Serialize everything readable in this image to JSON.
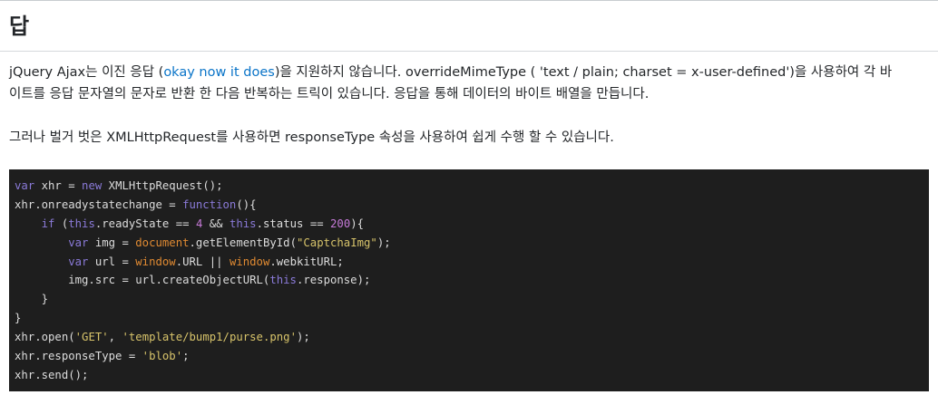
{
  "answer": {
    "heading": "답",
    "para1_before_link": "jQuery Ajax는 이진 응답 (",
    "para1_link": "okay now it does",
    "para1_after_link_line1": ")을 지원하지 않습니다. overrideMimeType ( 'text / plain; charset = x-user-defined')을 사용하여 각 바",
    "para1_line2": "이트를 응답 문자열의 문자로 반환 한 다음 반복하는 트릭이 있습니다. 응답을 통해 데이터의 바이트 배열을 만듭니다.",
    "para2": "그러나 벌거 벗은 XMLHttpRequest를 사용하면 responseType 속성을 사용하여 쉽게 수행 할 수 있습니다."
  },
  "code": {
    "lines": [
      [
        [
          "kw",
          "var"
        ],
        [
          "pl",
          " xhr = "
        ],
        [
          "kw",
          "new"
        ],
        [
          "pl",
          " XMLHttpRequest();"
        ]
      ],
      [
        [
          "pl",
          "xhr.onreadystatechange = "
        ],
        [
          "kw",
          "function"
        ],
        [
          "pl",
          "(){"
        ]
      ],
      [
        [
          "pl",
          "    "
        ],
        [
          "kw",
          "if"
        ],
        [
          "pl",
          " ("
        ],
        [
          "kw",
          "this"
        ],
        [
          "pl",
          ".readyState == "
        ],
        [
          "num",
          "4"
        ],
        [
          "pl",
          " && "
        ],
        [
          "kw",
          "this"
        ],
        [
          "pl",
          ".status == "
        ],
        [
          "num",
          "200"
        ],
        [
          "pl",
          "){"
        ]
      ],
      [
        [
          "pl",
          "        "
        ],
        [
          "kw",
          "var"
        ],
        [
          "pl",
          " img = "
        ],
        [
          "bi",
          "document"
        ],
        [
          "pl",
          ".getElementById("
        ],
        [
          "str",
          "\"CaptchaImg\""
        ],
        [
          "pl",
          ");"
        ]
      ],
      [
        [
          "pl",
          "        "
        ],
        [
          "kw",
          "var"
        ],
        [
          "pl",
          " url = "
        ],
        [
          "bi",
          "window"
        ],
        [
          "pl",
          ".URL || "
        ],
        [
          "bi",
          "window"
        ],
        [
          "pl",
          ".webkitURL;"
        ]
      ],
      [
        [
          "pl",
          "        img.src = url.createObjectURL("
        ],
        [
          "kw",
          "this"
        ],
        [
          "pl",
          ".response);"
        ]
      ],
      [
        [
          "pl",
          "    }"
        ]
      ],
      [
        [
          "pl",
          "}"
        ]
      ],
      [
        [
          "pl",
          "xhr.open("
        ],
        [
          "str",
          "'GET'"
        ],
        [
          "pl",
          ", "
        ],
        [
          "str",
          "'template/bump1/purse.png'"
        ],
        [
          "pl",
          ");"
        ]
      ],
      [
        [
          "pl",
          "xhr.responseType = "
        ],
        [
          "str",
          "'blob'"
        ],
        [
          "pl",
          ";"
        ]
      ],
      [
        [
          "pl",
          "xhr.send();"
        ]
      ]
    ]
  }
}
